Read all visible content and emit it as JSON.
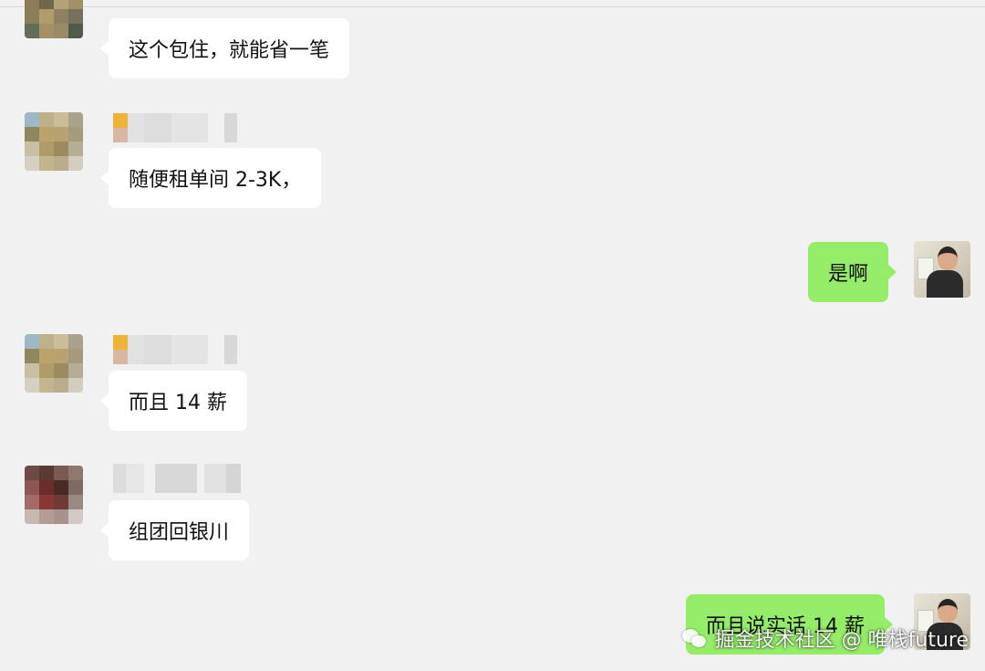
{
  "chat": {
    "messages": [
      {
        "text": "这个包住，就能省一笔"
      },
      {
        "text": "随便租单间 2-3K，"
      },
      {
        "text": "是啊"
      },
      {
        "text": "而且 14 薪"
      },
      {
        "text": "组团回银川"
      },
      {
        "text": "而且说实话 14 薪"
      }
    ]
  },
  "watermark": {
    "text": "掘金技术社区 @ 唯栈future",
    "icon": "wechat-icon"
  },
  "colors": {
    "background": "#f1f1f1",
    "incoming_bubble": "#ffffff",
    "outgoing_bubble": "#95ec69"
  }
}
